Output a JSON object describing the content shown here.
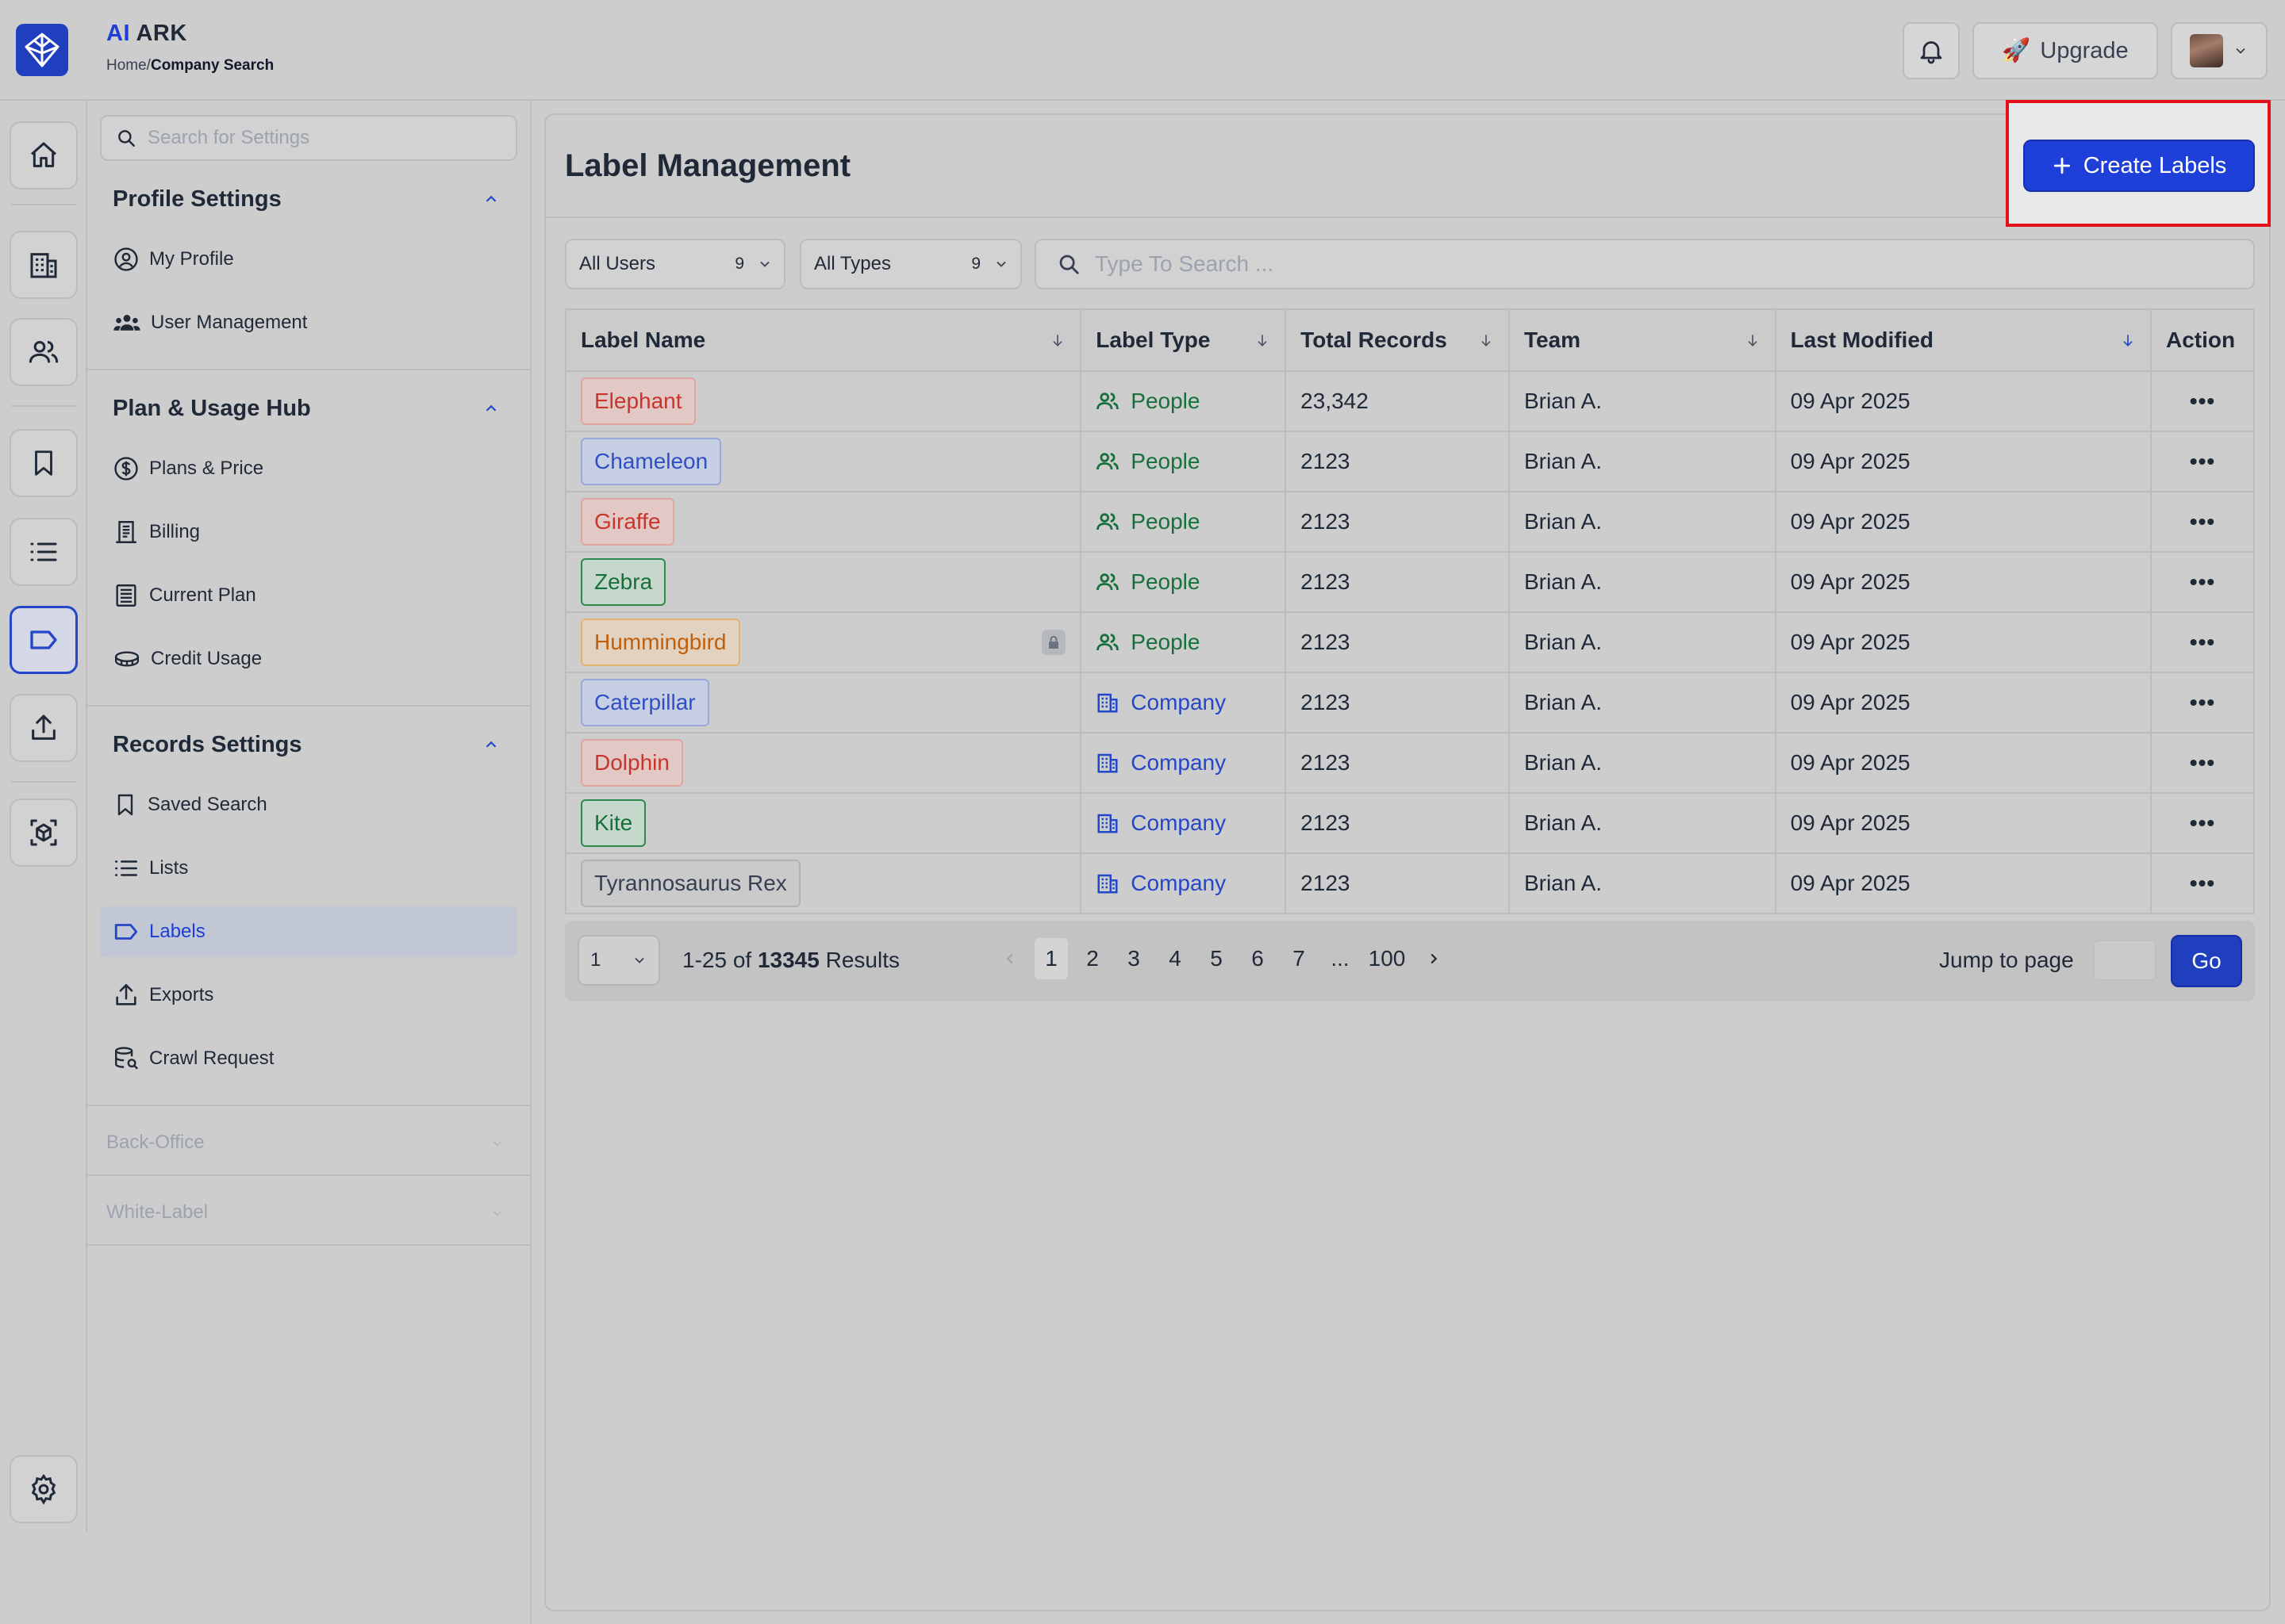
{
  "app": {
    "brand_ai": "AI",
    "brand_ark": "ARK"
  },
  "breadcrumb": {
    "home": "Home/",
    "current": "Company Search"
  },
  "header": {
    "upgrade_label": "Upgrade",
    "upgrade_emoji": "🚀"
  },
  "sidebar": {
    "search_placeholder": "Search for Settings",
    "profile": {
      "title": "Profile Settings",
      "items": [
        "My Profile",
        "User Management"
      ]
    },
    "plan": {
      "title": "Plan & Usage Hub",
      "items": [
        "Plans & Price",
        "Billing",
        "Current Plan",
        "Credit Usage"
      ]
    },
    "records": {
      "title": "Records Settings",
      "items": [
        "Saved Search",
        "Lists",
        "Labels",
        "Exports",
        "Crawl Request"
      ]
    },
    "back_office": "Back-Office",
    "white_label": "White-Label"
  },
  "main": {
    "title": "Label Management",
    "create_label": "Create Labels",
    "filters": {
      "users": {
        "label": "All Users",
        "count": "9"
      },
      "types": {
        "label": "All Types",
        "count": "9"
      }
    },
    "search_placeholder": "Type To Search ...",
    "columns": [
      "Label Name",
      "Label Type",
      "Total Records",
      "Team",
      "Last Modified",
      "Action"
    ],
    "rows": [
      {
        "name": "Elephant",
        "type": "People",
        "records": "23,342",
        "team": "Brian A.",
        "modified": "09 Apr 2025"
      },
      {
        "name": "Chameleon",
        "type": "People",
        "records": "2123",
        "team": "Brian A.",
        "modified": "09 Apr 2025"
      },
      {
        "name": "Giraffe",
        "type": "People",
        "records": "2123",
        "team": "Brian A.",
        "modified": "09 Apr 2025"
      },
      {
        "name": "Zebra",
        "type": "People",
        "records": "2123",
        "team": "Brian A.",
        "modified": "09 Apr 2025"
      },
      {
        "name": "Hummingbird",
        "type": "People",
        "records": "2123",
        "team": "Brian A.",
        "modified": "09 Apr 2025"
      },
      {
        "name": "Caterpillar",
        "type": "Company",
        "records": "2123",
        "team": "Brian A.",
        "modified": "09 Apr 2025"
      },
      {
        "name": "Dolphin",
        "type": "Company",
        "records": "2123",
        "team": "Brian A.",
        "modified": "09 Apr 2025"
      },
      {
        "name": "Kite",
        "type": "Company",
        "records": "2123",
        "team": "Brian A.",
        "modified": "09 Apr 2025"
      },
      {
        "name": "Tyrannosaurus Rex",
        "type": "Company",
        "records": "2123",
        "team": "Brian A.",
        "modified": "09 Apr 2025"
      }
    ],
    "action_label": "•••",
    "pagination": {
      "per_page": "1",
      "range": "1-25 of",
      "total": "13345",
      "results_word": "Results",
      "pages": [
        "1",
        "2",
        "3",
        "4",
        "5",
        "6",
        "7"
      ],
      "ellipsis": "...",
      "last_page": "100",
      "jump_label": "Jump to page",
      "go_label": "Go"
    }
  },
  "colors": {
    "accent": "#1f3fd9",
    "highlight": "#e3121a",
    "people": "#16703a",
    "company": "#2446c9"
  }
}
